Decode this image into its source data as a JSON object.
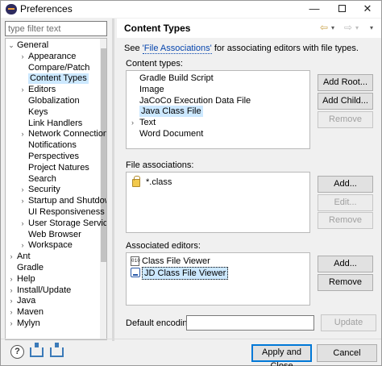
{
  "window": {
    "title": "Preferences",
    "minimize": "—",
    "close": "✕"
  },
  "filter": {
    "placeholder": "type filter text"
  },
  "tree": {
    "items": [
      {
        "label": "General",
        "arrow": "⌄"
      },
      {
        "label": "Appearance",
        "arrow": "›"
      },
      {
        "label": "Compare/Patch"
      },
      {
        "label": "Content Types",
        "selected": true
      },
      {
        "label": "Editors",
        "arrow": "›"
      },
      {
        "label": "Globalization"
      },
      {
        "label": "Keys"
      },
      {
        "label": "Link Handlers"
      },
      {
        "label": "Network Connections",
        "arrow": "›"
      },
      {
        "label": "Notifications"
      },
      {
        "label": "Perspectives"
      },
      {
        "label": "Project Natures"
      },
      {
        "label": "Search"
      },
      {
        "label": "Security",
        "arrow": "›"
      },
      {
        "label": "Startup and Shutdown",
        "arrow": "›"
      },
      {
        "label": "UI Responsiveness Mo"
      },
      {
        "label": "User Storage Service",
        "arrow": "›"
      },
      {
        "label": "Web Browser"
      },
      {
        "label": "Workspace",
        "arrow": "›"
      },
      {
        "label": "Ant",
        "arrow": "›"
      },
      {
        "label": "Gradle"
      },
      {
        "label": "Help",
        "arrow": "›"
      },
      {
        "label": "Install/Update",
        "arrow": "›"
      },
      {
        "label": "Java",
        "arrow": "›"
      },
      {
        "label": "Maven",
        "arrow": "›"
      },
      {
        "label": "Mylyn",
        "arrow": "›"
      }
    ]
  },
  "page": {
    "title": "Content Types",
    "desc_prefix": "See ",
    "desc_link": "'File Associations'",
    "desc_suffix": " for associating editors with file types."
  },
  "content_types": {
    "label": "Content types:",
    "items": [
      {
        "label": "Gradle Build Script"
      },
      {
        "label": "Image"
      },
      {
        "label": "JaCoCo Execution Data File"
      },
      {
        "label": "Java Class File",
        "selected": true
      },
      {
        "label": "Text",
        "expandable": true
      },
      {
        "label": "Word Document"
      }
    ],
    "buttons": {
      "add_root": "Add Root...",
      "add_child": "Add Child...",
      "remove": "Remove"
    }
  },
  "file_associations": {
    "label": "File associations:",
    "items": [
      {
        "label": "*.class",
        "icon": "lock-icon"
      }
    ],
    "buttons": {
      "add": "Add...",
      "edit": "Edit...",
      "remove": "Remove"
    }
  },
  "associated_editors": {
    "label": "Associated editors:",
    "items": [
      {
        "label": "Class File Viewer",
        "icon": "class-file-icon",
        "icon_text": "010"
      },
      {
        "label": "JD Class File Viewer",
        "icon": "jd-icon",
        "focused": true
      }
    ],
    "buttons": {
      "add": "Add...",
      "remove": "Remove"
    }
  },
  "encoding": {
    "label": "Default encoding:",
    "value": "",
    "update": "Update"
  },
  "footer": {
    "help": "?",
    "apply_close": "Apply and Close",
    "cancel": "Cancel"
  },
  "nav": {
    "back": "⇦",
    "drop": "▾",
    "forward": "⇨",
    "menu": "▾"
  },
  "colors": {
    "selection": "#cce8ff",
    "link": "#0645ad",
    "primary_border": "#0078d7"
  }
}
